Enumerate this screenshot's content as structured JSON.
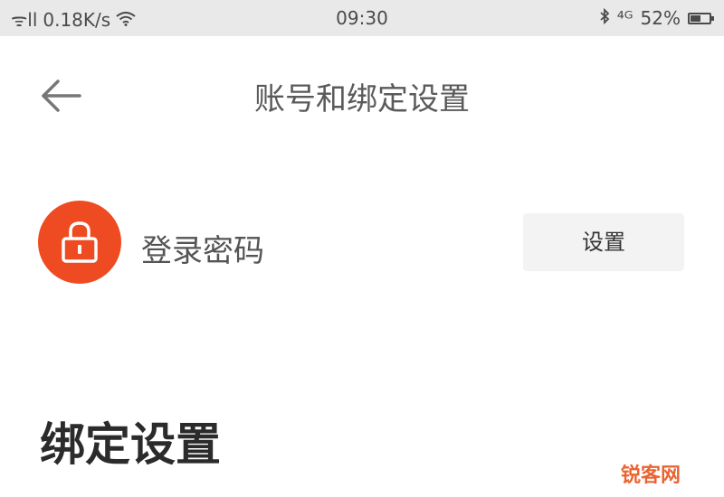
{
  "status_bar": {
    "signal": "ᯤll",
    "network_speed": "0.18K/s",
    "wifi_icon": "wifi-icon",
    "time": "09:30",
    "bluetooth_icon": "bluetooth-icon",
    "mobile_signal": "⁴ᴳ",
    "battery_percent": "52%",
    "battery_level": 0.52
  },
  "header": {
    "back_icon": "back-arrow-icon",
    "title": "账号和绑定设置"
  },
  "login_password": {
    "icon": "lock-icon",
    "icon_bg": "#ee4b22",
    "label": "登录密码",
    "action_label": "设置"
  },
  "binding_section": {
    "title": "绑定设置"
  },
  "watermark": {
    "text": "锐客网"
  }
}
